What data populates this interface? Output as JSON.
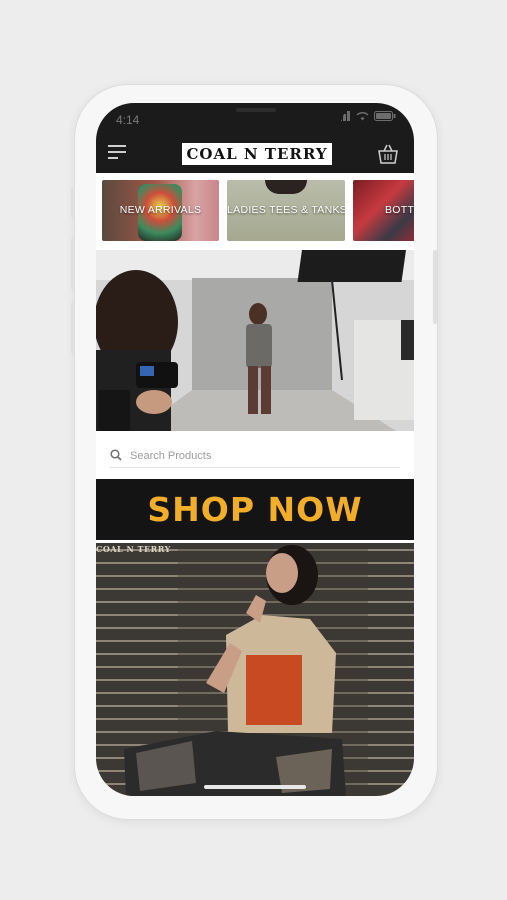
{
  "status_bar": {
    "time": "4:14"
  },
  "header": {
    "logo_text": "COAL N TERRY",
    "menu_icon": "hamburger-icon",
    "cart_icon": "basket-icon"
  },
  "categories": [
    {
      "label": "NEW ARRIVALS"
    },
    {
      "label": "LADIES TEES & TANKS"
    },
    {
      "label": "BOTT"
    }
  ],
  "search": {
    "placeholder": "Search Products"
  },
  "promo": {
    "headline": "SHOP NOW",
    "pattern_text": "COAL N TERRY"
  },
  "colors": {
    "header_bg": "#1b1b1b",
    "promo_accent": "#f2ae2a"
  }
}
